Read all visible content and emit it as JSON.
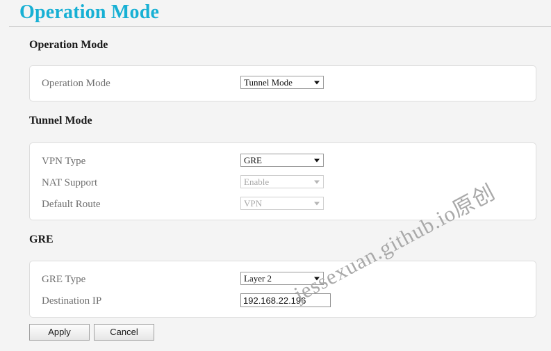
{
  "page": {
    "title": "Operation Mode",
    "accent_color": "#17b0d4",
    "background_color": "#f4f4f4",
    "panel_color": "#ffffff"
  },
  "sections": [
    {
      "heading": "Operation Mode",
      "rows": [
        {
          "label": "Operation Mode",
          "control": "select",
          "value": "Tunnel Mode",
          "disabled": false
        }
      ]
    },
    {
      "heading": "Tunnel Mode",
      "rows": [
        {
          "label": "VPN Type",
          "control": "select",
          "value": "GRE",
          "disabled": false
        },
        {
          "label": "NAT Support",
          "control": "select",
          "value": "Enable",
          "disabled": true
        },
        {
          "label": "Default Route",
          "control": "select",
          "value": "VPN",
          "disabled": true
        }
      ]
    },
    {
      "heading": "GRE",
      "rows": [
        {
          "label": "GRE Type",
          "control": "select",
          "value": "Layer 2",
          "disabled": false
        },
        {
          "label": "Destination IP",
          "control": "text",
          "value": "192.168.22.196",
          "disabled": false
        }
      ]
    }
  ],
  "buttons": {
    "apply": "Apply",
    "cancel": "Cancel"
  },
  "watermark": {
    "text": "jessexuan.github.io原创",
    "color": "#a9a9a9"
  }
}
